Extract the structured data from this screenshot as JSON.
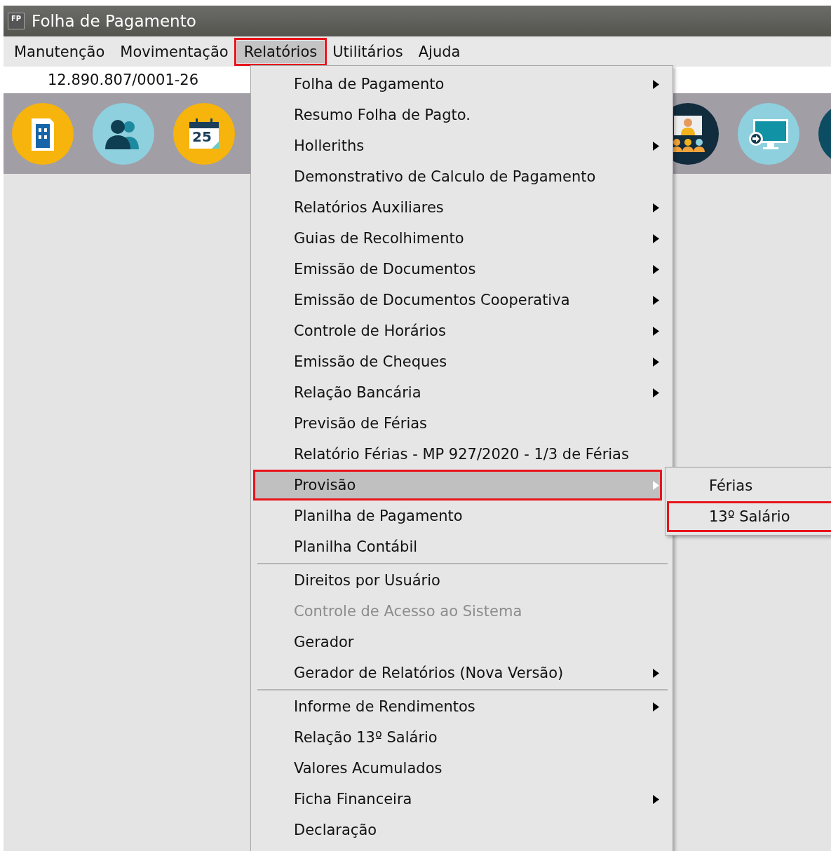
{
  "window": {
    "icon_label": "FP",
    "title": "Folha de Pagamento"
  },
  "menu_bar": [
    {
      "label": "Manutenção",
      "selected": false,
      "highlighted": false
    },
    {
      "label": "Movimentação",
      "selected": false,
      "highlighted": false
    },
    {
      "label": "Relatórios",
      "selected": true,
      "highlighted": true
    },
    {
      "label": "Utilitários",
      "selected": false,
      "highlighted": false
    },
    {
      "label": "Ajuda",
      "selected": false,
      "highlighted": false
    }
  ],
  "company_id": "12.890.807/0001-26",
  "toolbar": [
    {
      "kind": "building"
    },
    {
      "kind": "people"
    },
    {
      "kind": "calendar",
      "day": "25"
    },
    {
      "kind": "hidden"
    },
    {
      "kind": "hidden"
    },
    {
      "kind": "hidden"
    },
    {
      "kind": "hidden"
    },
    {
      "kind": "hidden"
    },
    {
      "kind": "presenter"
    },
    {
      "kind": "monitor"
    },
    {
      "kind": "round"
    }
  ],
  "menu": [
    {
      "kind": "item",
      "label": "Folha de Pagamento",
      "submenu": true,
      "disabled": false,
      "selected": false,
      "highlighted": false
    },
    {
      "kind": "item",
      "label": "Resumo Folha de Pagto.",
      "submenu": false,
      "disabled": false,
      "selected": false,
      "highlighted": false
    },
    {
      "kind": "item",
      "label": "Holleriths",
      "submenu": true,
      "disabled": false,
      "selected": false,
      "highlighted": false
    },
    {
      "kind": "item",
      "label": "Demonstrativo de Calculo de Pagamento",
      "submenu": false,
      "disabled": false,
      "selected": false,
      "highlighted": false
    },
    {
      "kind": "item",
      "label": "Relatórios Auxiliares",
      "submenu": true,
      "disabled": false,
      "selected": false,
      "highlighted": false
    },
    {
      "kind": "item",
      "label": "Guias de Recolhimento",
      "submenu": true,
      "disabled": false,
      "selected": false,
      "highlighted": false
    },
    {
      "kind": "item",
      "label": "Emissão de Documentos",
      "submenu": true,
      "disabled": false,
      "selected": false,
      "highlighted": false
    },
    {
      "kind": "item",
      "label": "Emissão de Documentos Cooperativa",
      "submenu": true,
      "disabled": false,
      "selected": false,
      "highlighted": false
    },
    {
      "kind": "item",
      "label": "Controle de Horários",
      "submenu": true,
      "disabled": false,
      "selected": false,
      "highlighted": false
    },
    {
      "kind": "item",
      "label": "Emissão de Cheques",
      "submenu": true,
      "disabled": false,
      "selected": false,
      "highlighted": false
    },
    {
      "kind": "item",
      "label": "Relação Bancária",
      "submenu": true,
      "disabled": false,
      "selected": false,
      "highlighted": false
    },
    {
      "kind": "item",
      "label": "Previsão de Férias",
      "submenu": false,
      "disabled": false,
      "selected": false,
      "highlighted": false
    },
    {
      "kind": "item",
      "label": "Relatório Férias - MP 927/2020 - 1/3 de Férias",
      "submenu": false,
      "disabled": false,
      "selected": false,
      "highlighted": false
    },
    {
      "kind": "item",
      "label": "Provisão",
      "submenu": true,
      "disabled": false,
      "selected": true,
      "highlighted": true
    },
    {
      "kind": "item",
      "label": "Planilha de Pagamento",
      "submenu": false,
      "disabled": false,
      "selected": false,
      "highlighted": false
    },
    {
      "kind": "item",
      "label": "Planilha Contábil",
      "submenu": false,
      "disabled": false,
      "selected": false,
      "highlighted": false
    },
    {
      "kind": "separator"
    },
    {
      "kind": "item",
      "label": "Direitos por Usuário",
      "submenu": false,
      "disabled": false,
      "selected": false,
      "highlighted": false
    },
    {
      "kind": "item",
      "label": "Controle de Acesso ao Sistema",
      "submenu": false,
      "disabled": true,
      "selected": false,
      "highlighted": false
    },
    {
      "kind": "item",
      "label": "Gerador",
      "submenu": false,
      "disabled": false,
      "selected": false,
      "highlighted": false
    },
    {
      "kind": "item",
      "label": "Gerador de Relatórios (Nova Versão)",
      "submenu": true,
      "disabled": false,
      "selected": false,
      "highlighted": false
    },
    {
      "kind": "separator"
    },
    {
      "kind": "item",
      "label": "Informe de Rendimentos",
      "submenu": true,
      "disabled": false,
      "selected": false,
      "highlighted": false
    },
    {
      "kind": "item",
      "label": "Relação 13º Salário",
      "submenu": false,
      "disabled": false,
      "selected": false,
      "highlighted": false
    },
    {
      "kind": "item",
      "label": "Valores Acumulados",
      "submenu": false,
      "disabled": false,
      "selected": false,
      "highlighted": false
    },
    {
      "kind": "item",
      "label": "Ficha Financeira",
      "submenu": true,
      "disabled": false,
      "selected": false,
      "highlighted": false
    },
    {
      "kind": "item",
      "label": "Declaração",
      "submenu": false,
      "disabled": false,
      "selected": false,
      "highlighted": false
    }
  ],
  "submenu": [
    {
      "label": "Férias",
      "selected": false,
      "highlighted": false
    },
    {
      "label": "13º Salário",
      "selected": false,
      "highlighted": true
    }
  ]
}
